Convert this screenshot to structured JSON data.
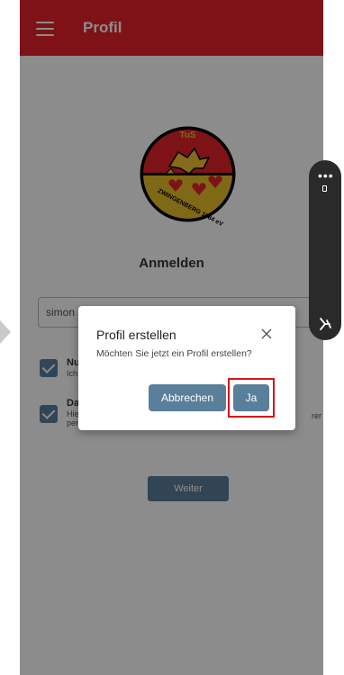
{
  "appbar": {
    "title": "Profil",
    "menu_icon": "hamburger-menu-icon",
    "color": "#e8212a"
  },
  "logo": {
    "text_top": "TuS",
    "text_ring": "ZWINGENBERG 1884 eV"
  },
  "login": {
    "title": "Anmelden",
    "username_value": "simon"
  },
  "checkboxes": [
    {
      "title": "Nu",
      "subtitle": "Ich"
    },
    {
      "title": "Da",
      "subtitle": "Hie",
      "subtitle2": "per",
      "trailing": "rer"
    }
  ],
  "weiter_button": {
    "label": "Weiter"
  },
  "dialog": {
    "title": "Profil erstellen",
    "message": "Möchten Sie jetzt ein Profil erstellen?",
    "cancel_label": "Abbrechen",
    "confirm_label": "Ja",
    "close_icon": "close-icon",
    "button_color": "#5a7f9b",
    "highlight_color": "#d8141a"
  },
  "side_handle": {
    "dots": "•••",
    "bottom_icon": "accessibility-icon"
  }
}
